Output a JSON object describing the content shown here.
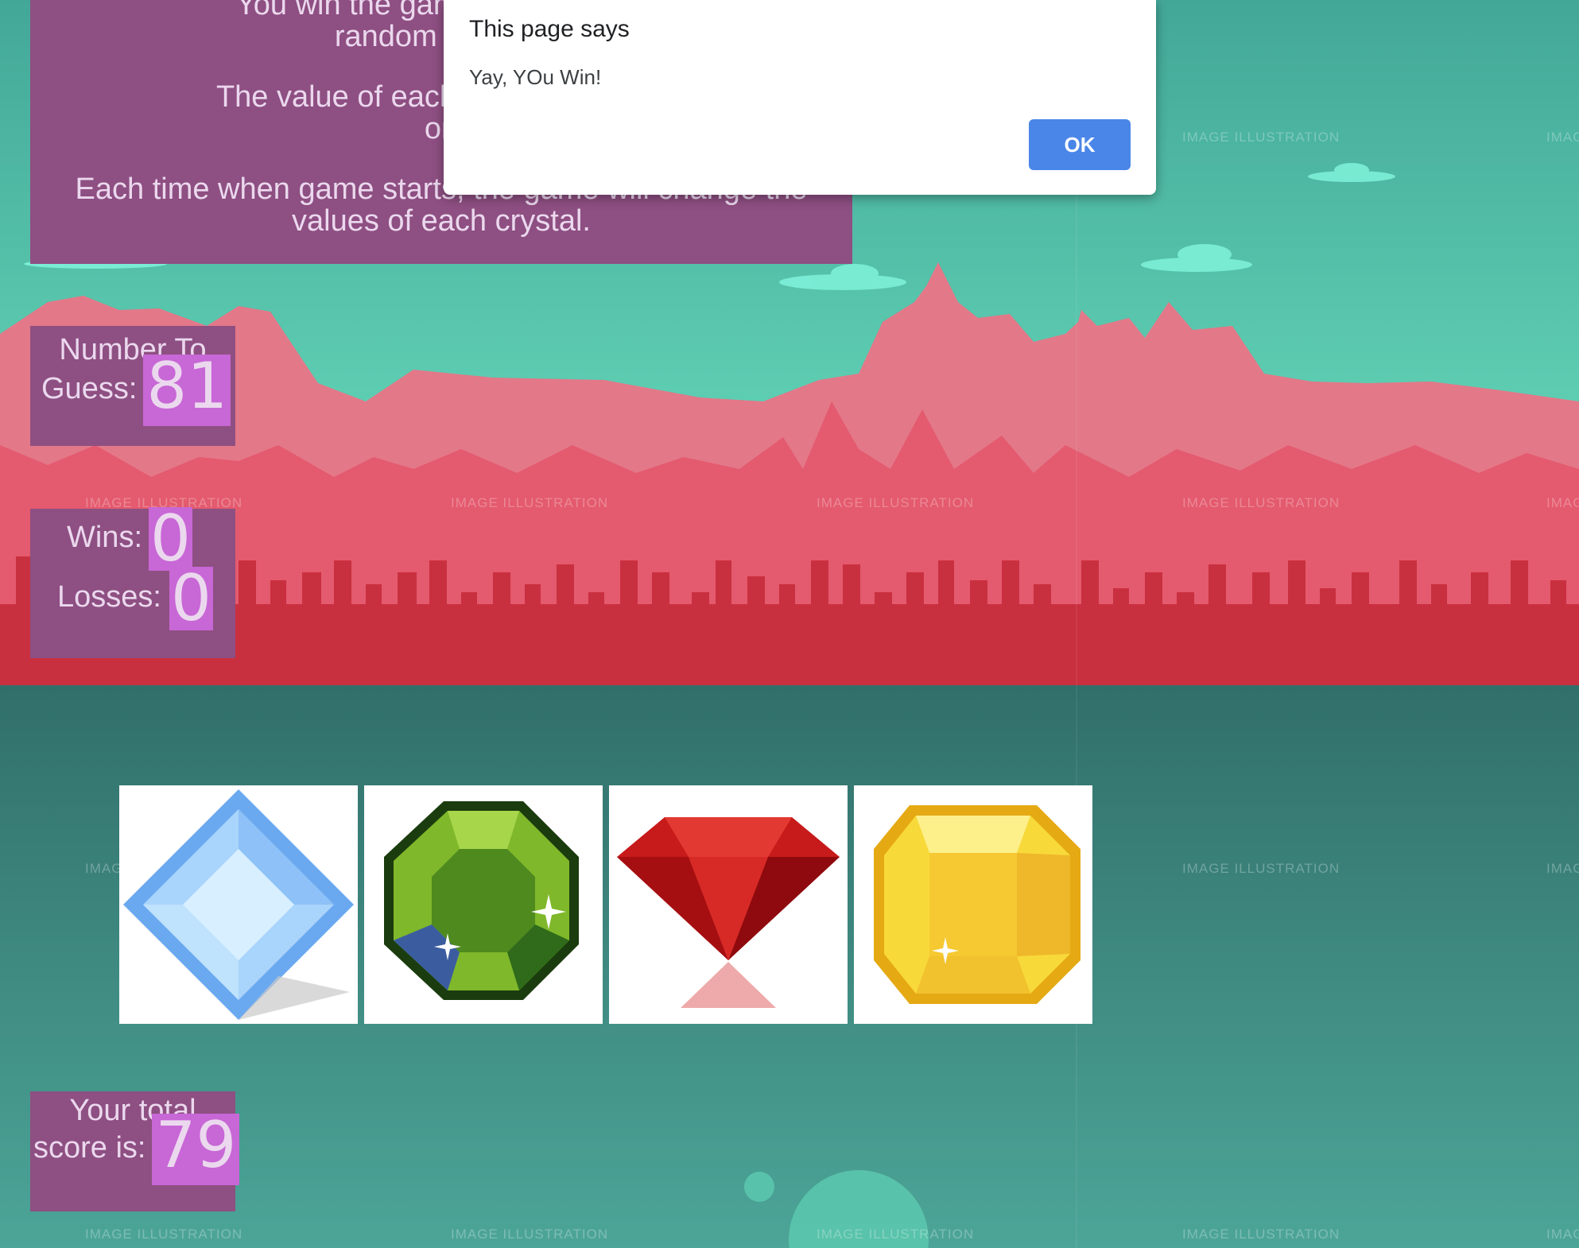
{
  "instructions": {
    "line1": "You win the game by matching",
    "line1b": "random number",
    "line2": "The value of each crystals hidden",
    "line2b": "on",
    "line3": "Each time when game starts, the game will change the",
    "line3b": "values of each crystal."
  },
  "target": {
    "label_top": "Number To",
    "label_bottom": "Guess:",
    "value": "81"
  },
  "record": {
    "wins_label": "Wins:",
    "wins_value": "0",
    "losses_label": "Losses:",
    "losses_value": "0"
  },
  "score": {
    "label_top": "Your total",
    "label_bottom": "score is:",
    "value": "79"
  },
  "crystals": [
    {
      "name": "blue",
      "icon": "blue-diamond-icon"
    },
    {
      "name": "green",
      "icon": "green-octagon-gem-icon"
    },
    {
      "name": "red",
      "icon": "red-ruby-icon"
    },
    {
      "name": "yellow",
      "icon": "yellow-topaz-icon"
    }
  ],
  "dialog": {
    "title": "This page says",
    "message": "Yay, YOu Win!",
    "ok_label": "OK"
  },
  "watermark": "IMAGE ILLUSTRATION",
  "colors": {
    "panel": "#8e4f82",
    "highlight": "#c867d6",
    "sky": "#64dbbd",
    "ground": "#367a73",
    "mountain": "#e0606f",
    "button": "#4a86e8"
  }
}
